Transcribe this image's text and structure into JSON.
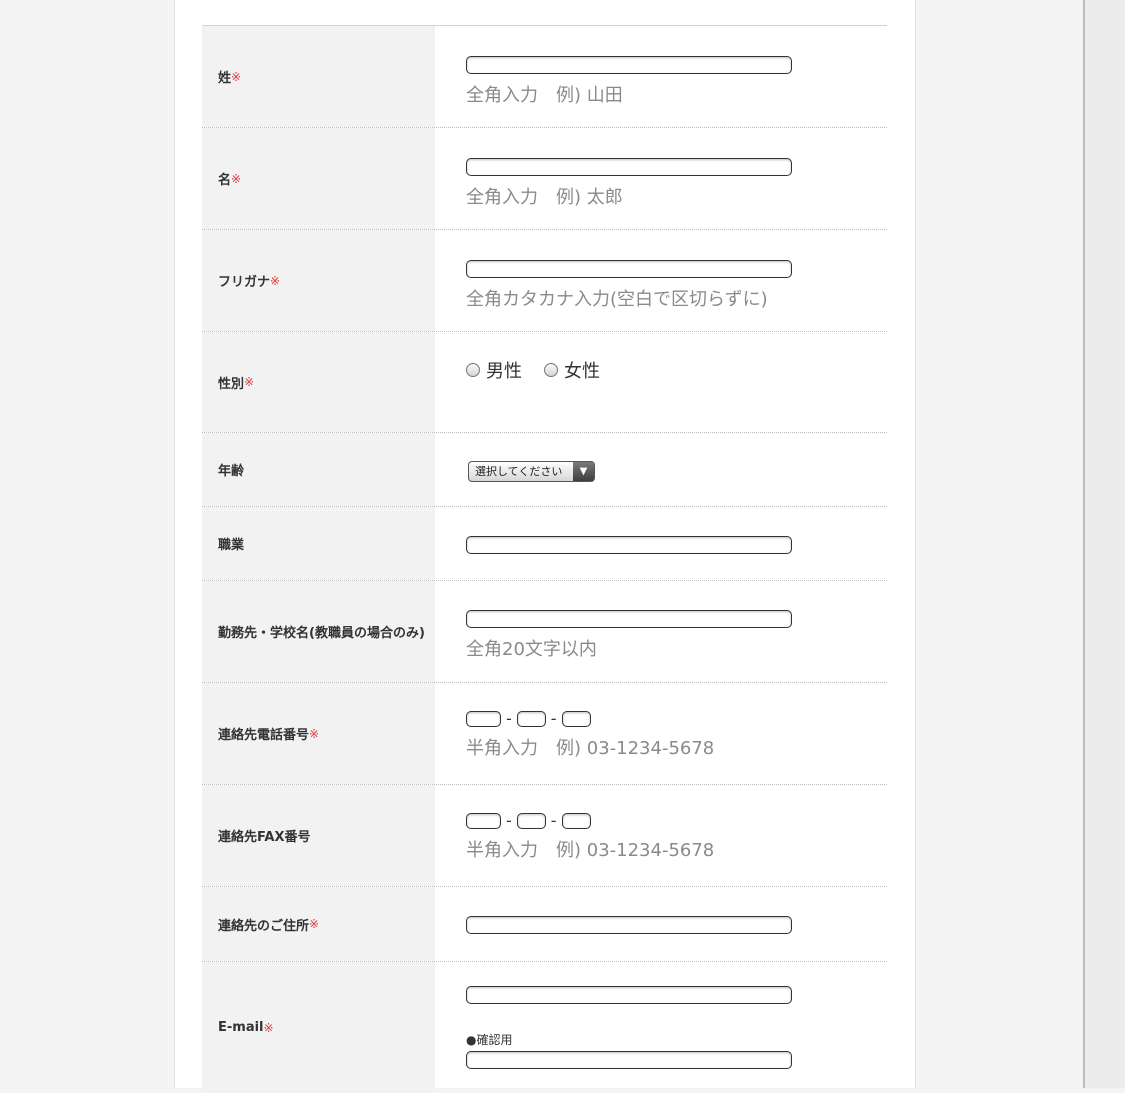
{
  "required_mark": "※",
  "form": {
    "last_name": {
      "label": "姓",
      "note": "全角入力　例) 山田"
    },
    "first_name": {
      "label": "名",
      "note": "全角入力　例) 太郎"
    },
    "furigana": {
      "label": "フリガナ",
      "note": "全角カタカナ入力(空白で区切らずに)"
    },
    "gender": {
      "label": "性別",
      "options": [
        "男性",
        "女性"
      ]
    },
    "age": {
      "label": "年齢",
      "select_value": "選択してください"
    },
    "occupation": {
      "label": "職業"
    },
    "workplace": {
      "label": "勤務先・学校名(教職員の場合のみ)",
      "note": "全角20文字以内"
    },
    "phone": {
      "label": "連絡先電話番号",
      "separator": "-",
      "note": "半角入力　例) 03-1234-5678"
    },
    "fax": {
      "label": "連絡先FAX番号",
      "separator": "-",
      "note": "半角入力　例) 03-1234-5678"
    },
    "address": {
      "label": "連絡先のご住所"
    },
    "email": {
      "label": "E-mail",
      "confirm_label": "●確認用"
    }
  },
  "colors": {
    "required": "#e03a3a",
    "label_bg": "#f2f2f2",
    "note": "#8a8a8a"
  },
  "icons": {
    "select_arrow": "▼"
  }
}
